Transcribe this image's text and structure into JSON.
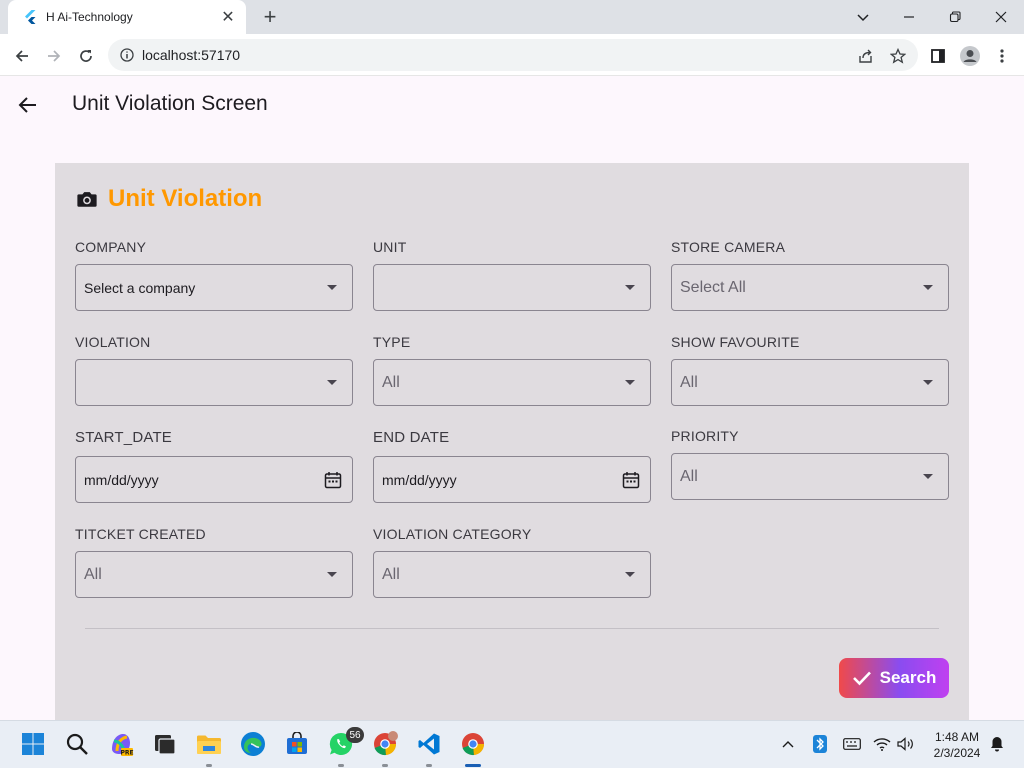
{
  "browser": {
    "tab_title": "H Ai-Technology",
    "url": "localhost:57170"
  },
  "app": {
    "title": "Unit Violation Screen"
  },
  "card": {
    "heading": "Unit Violation",
    "icon": "camera-icon",
    "heading_color": "#ff9800"
  },
  "filters": {
    "company": {
      "label": "COMPANY",
      "value": "Select a company"
    },
    "unit": {
      "label": "UNIT",
      "value": ""
    },
    "store_camera": {
      "label": "STORE CAMERA",
      "value": "Select All"
    },
    "violation": {
      "label": "VIOLATION",
      "value": ""
    },
    "type": {
      "label": "TYPE",
      "value": "All"
    },
    "show_favourite": {
      "label": "SHOW FAVOURITE",
      "value": "All"
    },
    "start_date": {
      "label": "START_DATE",
      "placeholder": "mm/dd/yyyy"
    },
    "end_date": {
      "label": "END DATE",
      "placeholder": "mm/dd/yyyy"
    },
    "priority": {
      "label": "PRIORITY",
      "value": "All"
    },
    "ticket_created": {
      "label": "TITCKET CREATED",
      "value": "All"
    },
    "violation_category": {
      "label": "VIOLATION CATEGORY",
      "value": "All"
    }
  },
  "actions": {
    "search_label": "Search"
  },
  "taskbar": {
    "whatsapp_badge": "56",
    "time": "1:48 AM",
    "date": "2/3/2024"
  }
}
